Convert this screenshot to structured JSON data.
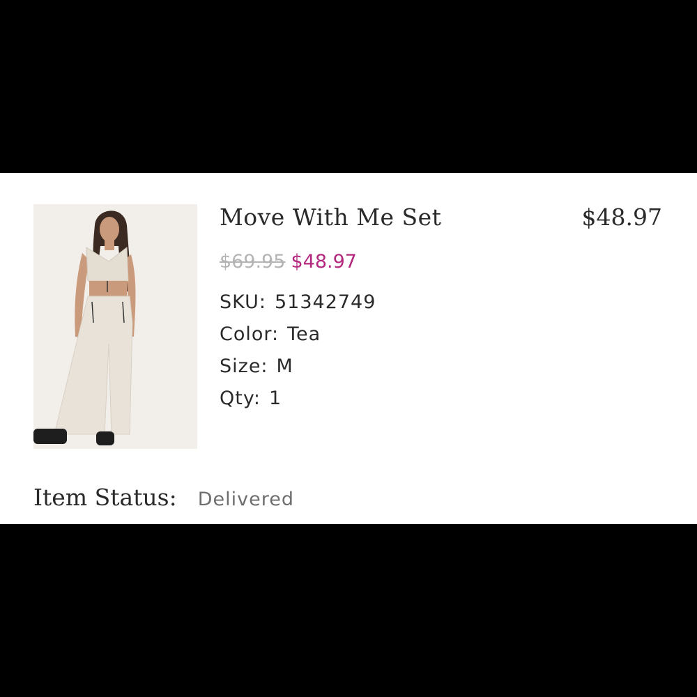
{
  "item": {
    "name": "Move With Me Set",
    "line_total": "$48.97",
    "original_price": "$69.95",
    "sale_price": "$48.97",
    "sku": {
      "label": "SKU:",
      "value": "51342749"
    },
    "color": {
      "label": "Color:",
      "value": "Tea"
    },
    "size": {
      "label": "Size:",
      "value": "M"
    },
    "qty": {
      "label": "Qty:",
      "value": "1"
    },
    "image": "product-photo"
  },
  "status": {
    "label": "Item Status:",
    "value": "Delivered"
  },
  "colors": {
    "background": "#000000",
    "card": "#ffffff",
    "text": "#2a2a2a",
    "sale": "#b3287e",
    "strike": "#b4b4b4",
    "status_value": "#6e6e6e"
  }
}
